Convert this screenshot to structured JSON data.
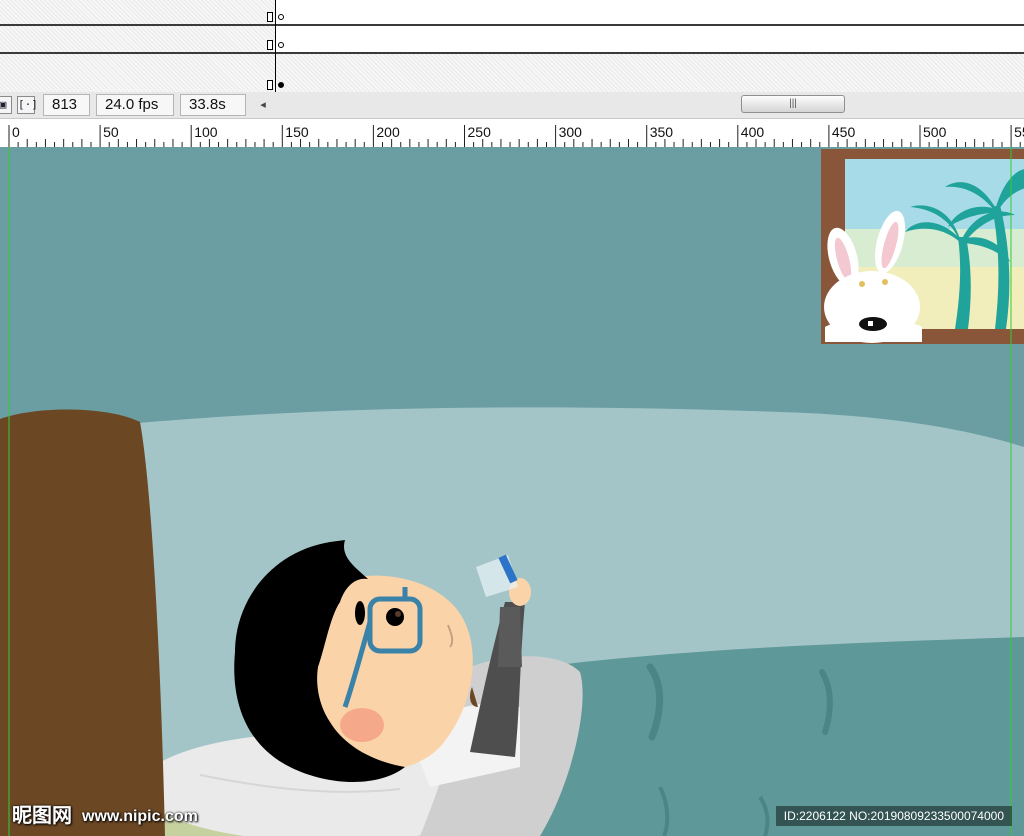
{
  "timeline": {
    "layers": [
      {
        "keyframe_type": "empty"
      },
      {
        "keyframe_type": "empty"
      },
      {
        "keyframe_type": "filled"
      }
    ]
  },
  "status": {
    "frame": "813",
    "fps": "24.0 fps",
    "time": "33.8s",
    "scroll_left_glyph": "◂",
    "scroll_thumb_glyph": "|||",
    "icons": [
      "onion-skin-icon",
      "center-frame-icon"
    ]
  },
  "ruler": {
    "labels": [
      "0",
      "50",
      "100",
      "150",
      "200",
      "250",
      "300",
      "350",
      "400",
      "450",
      "500",
      "55"
    ]
  },
  "stage": {
    "colors": {
      "wall": "#6a9ea3",
      "bed_sheet": "#a3c5c8",
      "headboard": "#6b4724",
      "blanket": "#5f9898",
      "skin": "#fbd3a9",
      "hair": "#000000",
      "glasses": "#3a82a8",
      "frame": "#8a563a",
      "guide_line": "#33cc33"
    }
  },
  "watermark": {
    "logo": "昵图网",
    "url": "www.nipic.com",
    "id": "ID:2206122 NO:20190809233500074000"
  }
}
